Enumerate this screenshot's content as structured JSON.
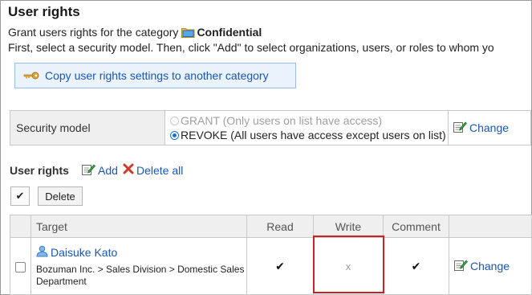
{
  "title": "User rights",
  "intro": {
    "prefix": "Grant users rights for the category",
    "category": "Confidential",
    "instructions": "First, select a security model. Then, click \"Add\" to select organizations, users, or roles to whom yo"
  },
  "copy_button_label": "Copy user rights settings to another category",
  "security_model": {
    "label": "Security model",
    "options": [
      {
        "text": "GRANT (Only users on list have access)",
        "selected": false,
        "disabled": true
      },
      {
        "text": "REVOKE (All users have access except users on list)",
        "selected": true,
        "disabled": false
      }
    ],
    "change_label": "Change"
  },
  "user_rights": {
    "heading": "User rights",
    "add_label": "Add",
    "delete_all_label": "Delete all",
    "check_all_glyph": "✔",
    "delete_label": "Delete",
    "columns": [
      "Target",
      "Read",
      "Write",
      "Comment"
    ],
    "rows": [
      {
        "user": "Daisuke Kato",
        "org": "Bozuman Inc. > Sales Division > Domestic Sales Department",
        "read": "✔",
        "write": "x",
        "comment": "✔",
        "change_label": "Change"
      }
    ]
  },
  "colors": {
    "link": "#1a56b8",
    "highlight": "#cc2222",
    "header_bg": "#efefef"
  },
  "icons": [
    "folder-icon",
    "key-icon",
    "edit-icon",
    "delete-x-icon",
    "user-icon"
  ]
}
